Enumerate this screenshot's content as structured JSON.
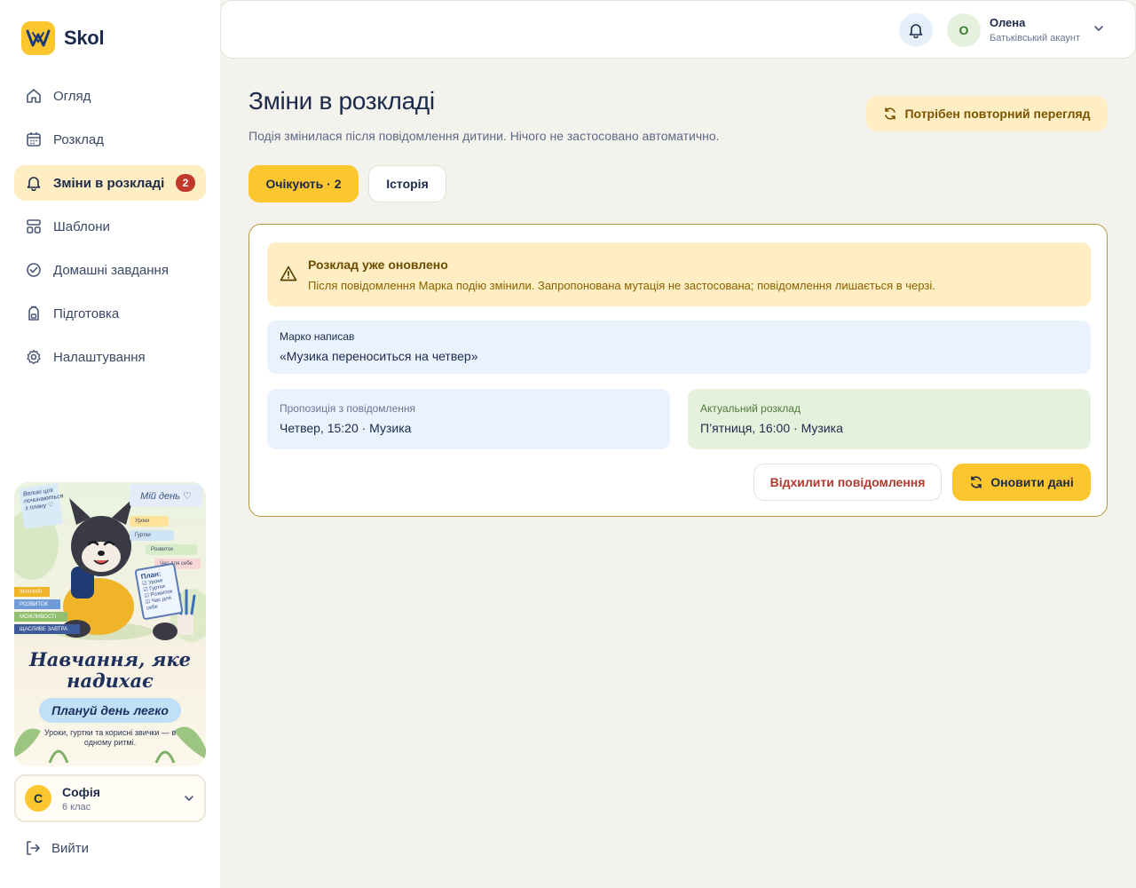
{
  "brand": {
    "name": "Skol"
  },
  "sidebar": {
    "items": [
      {
        "label": "Огляд",
        "icon": "home-icon"
      },
      {
        "label": "Розклад",
        "icon": "calendar-icon"
      },
      {
        "label": "Зміни в розкладі",
        "icon": "bell-icon",
        "badge": "2",
        "active": true
      },
      {
        "label": "Шаблони",
        "icon": "templates-icon"
      },
      {
        "label": "Домашні завдання",
        "icon": "check-circle-icon"
      },
      {
        "label": "Підготовка",
        "icon": "backpack-icon"
      },
      {
        "label": "Налаштування",
        "icon": "gear-icon"
      }
    ],
    "promo": {
      "title": "Навчання, яке надихає",
      "pill": "Плануй день легко",
      "subtitle": "Уроки, гуртки та корисні звички — в одному ритмі.",
      "board": "Мій день ♡",
      "note": "Великі цілі починаються з плану ♡",
      "tags": [
        "Уроки",
        "Гуртки",
        "Розвиток",
        "Час для себе"
      ],
      "books": [
        "ЗНАННЯ",
        "РОЗВИТОК",
        "МОЖЛИВОСТІ",
        "ЩАСЛИВЕ ЗАВТРА"
      ],
      "notebook_title": "План:",
      "notebook_items": [
        "☑ Уроки",
        "☑ Гуртки",
        "☑ Розвиток",
        "☑ Час для себе"
      ]
    },
    "profile": {
      "initial": "С",
      "name": "Софія",
      "grade": "6 клас"
    },
    "logout_label": "Вийти"
  },
  "topbar": {
    "user_initial": "О",
    "user_name": "Олена",
    "user_role": "Батьківський акаунт"
  },
  "main": {
    "title": "Зміни в розкладі",
    "subtitle": "Подія змінилася після повідомлення дитини. Нічого не застосовано автоматично.",
    "review_button": "Потрібен повторний перегляд",
    "tabs": [
      {
        "label": "Очікують · 2",
        "active": true
      },
      {
        "label": "Історія",
        "active": false
      }
    ],
    "card": {
      "warning_title": "Розклад уже оновлено",
      "warning_text": "Після повідомлення Марка подію змінили. Запропонована мутація не застосована; повідомлення лишається в черзі.",
      "message_label": "Марко написав",
      "message_text": "«Музика переноситься на четвер»",
      "proposal_label": "Пропозиція з повідомлення",
      "proposal_value": "Четвер, 15:20 · Музика",
      "actual_label": "Актуальний розклад",
      "actual_value": "П’ятниця, 16:00 · Музика",
      "reject_button": "Відхилити повідомлення",
      "refresh_button": "Оновити дані"
    }
  },
  "colors": {
    "accent": "#fcc62f",
    "accent_soft": "#ffeec3",
    "danger": "#c0392b",
    "card_border": "#b7963f"
  }
}
